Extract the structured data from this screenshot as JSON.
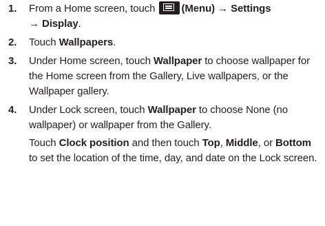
{
  "steps": [
    {
      "number": "1.",
      "pre": "From a Home screen, touch ",
      "icon_name": "menu-icon",
      "menu_label": "(Menu) → Settings",
      "line2": "→ Display",
      "end": "."
    },
    {
      "number": "2.",
      "pre": "Touch ",
      "bold": "Wallpapers",
      "end": "."
    },
    {
      "number": "3.",
      "pre": "Under Home screen, touch ",
      "bold": "Wallpaper",
      "post": " to choose wallpaper for the Home screen from the Gallery, Live wallpapers, or the Wallpaper gallery."
    },
    {
      "number": "4.",
      "pre": "Under Lock screen, touch ",
      "bold": "Wallpaper",
      "post": " to choose None (no wallpaper) or wallpaper from the Gallery.",
      "sub": {
        "pre": "Touch ",
        "bold1": "Clock position",
        "mid1": " and then touch ",
        "bold2": "Top",
        "mid2": ", ",
        "bold3": "Middle",
        "mid3": ", or ",
        "bold4": "Bottom",
        "post": " to set the location of the time, day, and date on the Lock screen."
      }
    }
  ]
}
